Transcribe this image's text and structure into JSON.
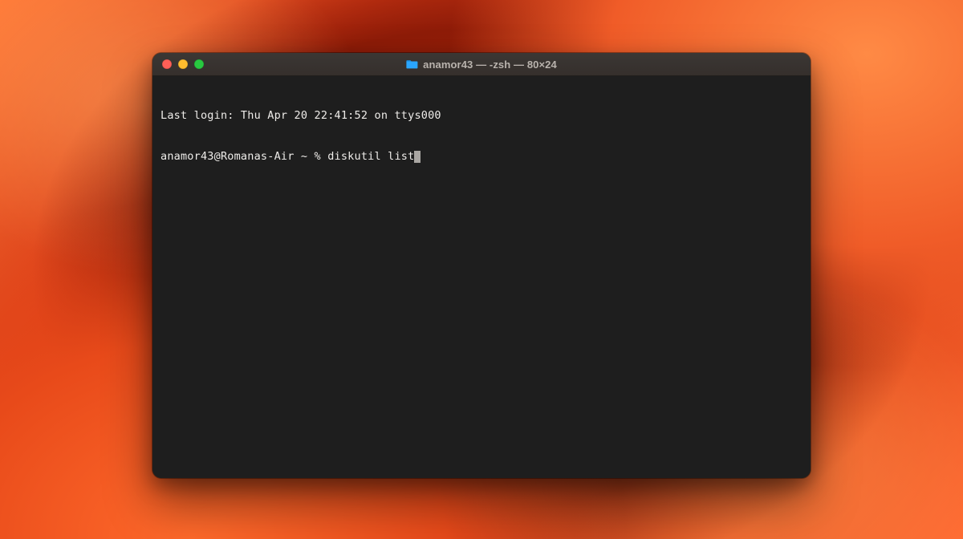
{
  "window": {
    "title": "anamor43 — -zsh — 80×24",
    "folder_icon_color": "#2aa6ff"
  },
  "traffic_lights": {
    "close": "close",
    "minimize": "minimize",
    "zoom": "zoom"
  },
  "terminal": {
    "last_login": "Last login: Thu Apr 20 22:41:52 on ttys000",
    "prompt": "anamor43@Romanas-Air ~ % ",
    "command": "diskutil list"
  }
}
